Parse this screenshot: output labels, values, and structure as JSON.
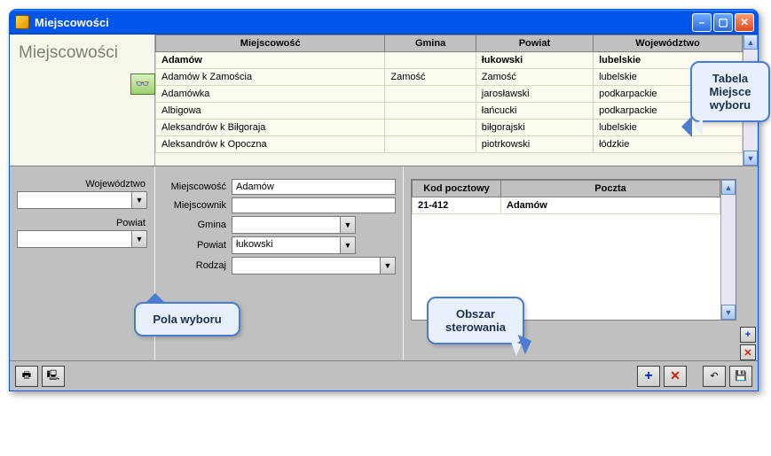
{
  "window": {
    "title": "Miejscowości"
  },
  "heading": "Miejscowości",
  "columns": {
    "c1": "Miejscowość",
    "c2": "Gmina",
    "c3": "Powiat",
    "c4": "Województwo"
  },
  "rows": [
    {
      "miejscowosc": "Adamów",
      "gmina": "",
      "powiat": "łukowski",
      "woj": "lubelskie",
      "selected": true
    },
    {
      "miejscowosc": "Adamów k Zamościa",
      "gmina": "Zamość",
      "powiat": "Zamość",
      "woj": "lubelskie"
    },
    {
      "miejscowosc": "Adamówka",
      "gmina": "",
      "powiat": "jarosławski",
      "woj": "podkarpackie"
    },
    {
      "miejscowosc": "Albigowa",
      "gmina": "",
      "powiat": "łańcucki",
      "woj": "podkarpackie"
    },
    {
      "miejscowosc": "Aleksandrów k Biłgoraja",
      "gmina": "",
      "powiat": "biłgorajski",
      "woj": "lubelskie"
    },
    {
      "miejscowosc": "Aleksandrów k Opoczna",
      "gmina": "",
      "powiat": "piotrkowski",
      "woj": "łódzkie"
    }
  ],
  "filters": {
    "woj_label": "Województwo",
    "powiat_label": "Powiat"
  },
  "form": {
    "miejscowosc_label": "Miejscowość",
    "miejscowosc_value": "Adamów",
    "miejscownik_label": "Miejscownik",
    "miejscownik_value": "",
    "gmina_label": "Gmina",
    "gmina_value": "",
    "powiat_label": "Powiat",
    "powiat_value": "łukowski",
    "rodzaj_label": "Rodzaj",
    "rodzaj_value": ""
  },
  "postal": {
    "col1": "Kod pocztowy",
    "col2": "Poczta",
    "rows": [
      {
        "kod": "21-412",
        "poczta": "Adamów"
      }
    ]
  },
  "callouts": {
    "c1a": "Tabela",
    "c1b": "Miejsce",
    "c1c": "wyboru",
    "c2": "Pola wyboru",
    "c3a": "Obszar",
    "c3b": "sterowania"
  }
}
